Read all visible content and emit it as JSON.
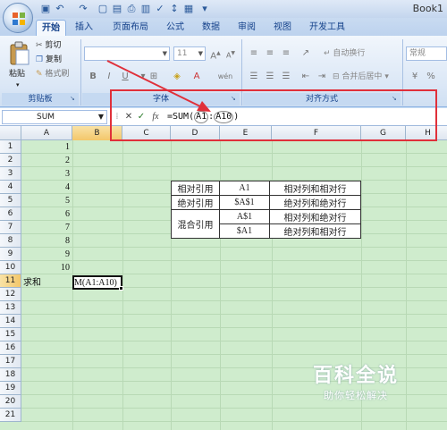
{
  "window": {
    "title": "Book1"
  },
  "tabs": [
    "开始",
    "插入",
    "页面布局",
    "公式",
    "数据",
    "审阅",
    "视图",
    "开发工具"
  ],
  "active_tab": "开始",
  "clipboard": {
    "paste": "粘贴",
    "cut": "剪切",
    "copy": "复制",
    "format_painter": "格式刷",
    "caption": "剪贴板"
  },
  "font": {
    "name": "",
    "size": "11",
    "caption": "字体",
    "bold": "B",
    "italic": "I",
    "underline": "U",
    "grow": "A",
    "shrink": "A",
    "font_color": "A",
    "phonetic": "wén"
  },
  "alignment": {
    "wrap_text": "自动换行",
    "merge_center": "合并后居中",
    "caption": "对齐方式"
  },
  "number": {
    "format": "常规"
  },
  "formula_bar": {
    "name_box": "SUM",
    "cancel": "✕",
    "enter": "✓",
    "fx": "fx",
    "formula_prefix": "=SUM(",
    "ref1": "A1",
    "colon": ":",
    "ref2": "A10",
    "formula_suffix": ")"
  },
  "sheet": {
    "columns": [
      "A",
      "B",
      "C",
      "D",
      "E",
      "F",
      "G",
      "H"
    ],
    "rows": [
      "1",
      "2",
      "3",
      "4",
      "5",
      "6",
      "7",
      "8",
      "9",
      "10",
      "11",
      "12",
      "13",
      "14",
      "15",
      "16",
      "17",
      "18",
      "19",
      "20",
      "21"
    ],
    "a_values": [
      "1",
      "2",
      "3",
      "4",
      "5",
      "6",
      "7",
      "8",
      "9",
      "10"
    ],
    "a11": "求和",
    "b11": "M(A1:A10)"
  },
  "ref_table": {
    "rows": [
      {
        "type": "相对引用",
        "ref": "A1",
        "desc": "相对列和相对行"
      },
      {
        "type": "绝对引用",
        "ref": "$A$1",
        "desc": "绝对列和绝对行"
      },
      {
        "type": "混合引用",
        "ref": "A$1",
        "desc": "相对列和绝对行"
      },
      {
        "type": "",
        "ref": "$A1",
        "desc": "绝对列和相对行"
      }
    ]
  },
  "watermark": {
    "title": "百科全说",
    "subtitle": "助你轻松解决"
  },
  "colors": {
    "highlight": "#e0303a",
    "grid_bg": "#cfeccd",
    "ribbon_text": "#15428b"
  }
}
